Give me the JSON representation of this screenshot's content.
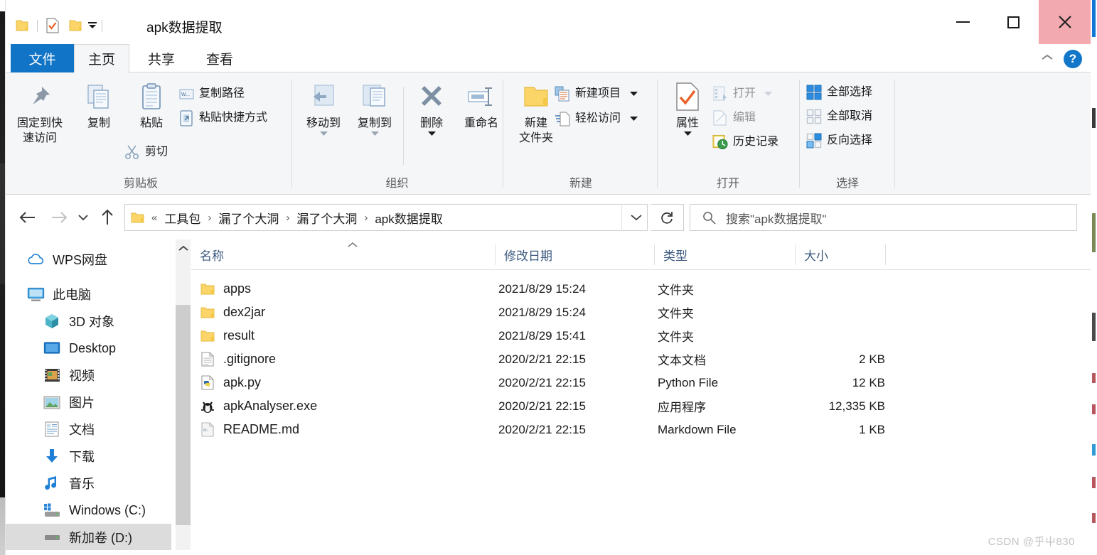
{
  "window": {
    "title": "apk数据提取",
    "quick_access": [
      "folder-icon",
      "properties-check-icon",
      "new-folder-icon"
    ],
    "minimize_label": "最小化",
    "maximize_label": "最大化",
    "close_label": "关闭"
  },
  "tabs": [
    {
      "label": "文件",
      "id": "file",
      "state": "file-menu"
    },
    {
      "label": "主页",
      "id": "home",
      "state": "active"
    },
    {
      "label": "共享",
      "id": "share",
      "state": "normal"
    },
    {
      "label": "查看",
      "id": "view",
      "state": "normal"
    }
  ],
  "ribbon": {
    "help_label": "?",
    "groups": [
      {
        "title": "剪贴板",
        "big": [
          {
            "label_line1": "固定到快",
            "label_line2": "速访问",
            "icon": "pin-icon"
          },
          {
            "label_line1": "复制",
            "label_line2": "",
            "icon": "copy-icon"
          },
          {
            "label_line1": "粘贴",
            "label_line2": "",
            "icon": "paste-icon"
          }
        ],
        "small": [
          {
            "label": "复制路径",
            "icon": "copy-path-icon"
          },
          {
            "label": "粘贴快捷方式",
            "icon": "paste-shortcut-icon"
          },
          {
            "label": "剪切",
            "icon": "scissors-icon"
          }
        ]
      },
      {
        "title": "组织",
        "big": [
          {
            "label_line1": "移动到",
            "label_line2": "",
            "icon": "move-to-icon",
            "has_caret": true
          },
          {
            "label_line1": "复制到",
            "label_line2": "",
            "icon": "copy-to-icon",
            "has_caret": true
          },
          {
            "label_line1": "删除",
            "label_line2": "",
            "icon": "delete-x-icon",
            "has_caret": true
          },
          {
            "label_line1": "重命名",
            "label_line2": "",
            "icon": "rename-icon"
          }
        ],
        "small": []
      },
      {
        "title": "新建",
        "big": [
          {
            "label_line1": "新建",
            "label_line2": "文件夹",
            "icon": "new-folder-icon"
          }
        ],
        "small": [
          {
            "label": "新建项目",
            "icon": "new-item-icon",
            "has_caret": true
          },
          {
            "label": "轻松访问",
            "icon": "easy-access-icon",
            "has_caret": true
          }
        ]
      },
      {
        "title": "打开",
        "big": [
          {
            "label_line1": "属性",
            "label_line2": "",
            "icon": "properties-icon",
            "has_caret": true
          }
        ],
        "small": [
          {
            "label": "打开",
            "icon": "open-icon",
            "has_caret": true
          },
          {
            "label": "编辑",
            "icon": "edit-icon"
          },
          {
            "label": "历史记录",
            "icon": "history-icon"
          }
        ]
      },
      {
        "title": "选择",
        "big": [],
        "small": [
          {
            "label": "全部选择",
            "icon": "select-all-icon"
          },
          {
            "label": "全部取消",
            "icon": "select-none-icon"
          },
          {
            "label": "反向选择",
            "icon": "invert-selection-icon"
          }
        ]
      }
    ]
  },
  "address": {
    "back_icon": "back-arrow-icon",
    "forward_icon": "forward-arrow-icon",
    "recent_icon": "chevron-down-icon",
    "up_icon": "up-arrow-icon",
    "leading": "«",
    "crumbs": [
      "工具包",
      "漏了个大洞",
      "漏了个大洞",
      "apk数据提取"
    ],
    "separator": "›",
    "dropdown_icon": "chevron-down-icon",
    "refresh_icon": "refresh-icon",
    "search_placeholder": "搜索\"apk数据提取\"",
    "search_value": ""
  },
  "navpane": {
    "items": [
      {
        "label": "WPS网盘",
        "icon": "cloud-icon",
        "indent": 0,
        "selected": false
      },
      {
        "label": "此电脑",
        "icon": "computer-icon",
        "indent": 0,
        "selected": false
      },
      {
        "label": "3D 对象",
        "icon": "3d-objects-icon",
        "indent": 1,
        "selected": false
      },
      {
        "label": "Desktop",
        "icon": "desktop-icon",
        "indent": 1,
        "selected": false
      },
      {
        "label": "视频",
        "icon": "videos-icon",
        "indent": 1,
        "selected": false
      },
      {
        "label": "图片",
        "icon": "pictures-icon",
        "indent": 1,
        "selected": false
      },
      {
        "label": "文档",
        "icon": "documents-icon",
        "indent": 1,
        "selected": false
      },
      {
        "label": "下载",
        "icon": "downloads-icon",
        "indent": 1,
        "selected": false
      },
      {
        "label": "音乐",
        "icon": "music-icon",
        "indent": 1,
        "selected": false
      },
      {
        "label": "Windows (C:)",
        "icon": "drive-system-icon",
        "indent": 1,
        "selected": false
      },
      {
        "label": "新加卷 (D:)",
        "icon": "drive-icon",
        "indent": 1,
        "selected": true
      }
    ]
  },
  "filelist": {
    "columns": [
      "名称",
      "修改日期",
      "类型",
      "大小"
    ],
    "sort_column": "名称",
    "sort_direction": "asc",
    "rows": [
      {
        "name": "apps",
        "date": "2021/8/29 15:24",
        "type": "文件夹",
        "size": "",
        "icon": "folder-icon"
      },
      {
        "name": "dex2jar",
        "date": "2021/8/29 15:24",
        "type": "文件夹",
        "size": "",
        "icon": "folder-icon"
      },
      {
        "name": "result",
        "date": "2021/8/29 15:41",
        "type": "文件夹",
        "size": "",
        "icon": "folder-icon"
      },
      {
        "name": ".gitignore",
        "date": "2020/2/21 22:15",
        "type": "文本文档",
        "size": "2 KB",
        "icon": "text-file-icon"
      },
      {
        "name": "apk.py",
        "date": "2020/2/21 22:15",
        "type": "Python File",
        "size": "12 KB",
        "icon": "python-file-icon"
      },
      {
        "name": "apkAnalyser.exe",
        "date": "2020/2/21 22:15",
        "type": "应用程序",
        "size": "12,335 KB",
        "icon": "exe-file-icon"
      },
      {
        "name": "README.md",
        "date": "2020/2/21 22:15",
        "type": "Markdown File",
        "size": "1 KB",
        "icon": "markdown-file-icon"
      }
    ]
  },
  "watermark": "CSDN @乎屮830",
  "colors": {
    "accent": "#1274c6",
    "close_hover": "#f2a9b0",
    "ribbon_bg": "#f4f6f8",
    "folder_yellow": "#fcd568",
    "column_header_text": "#3d5a80",
    "selection_bg": "#dcdcdc"
  }
}
